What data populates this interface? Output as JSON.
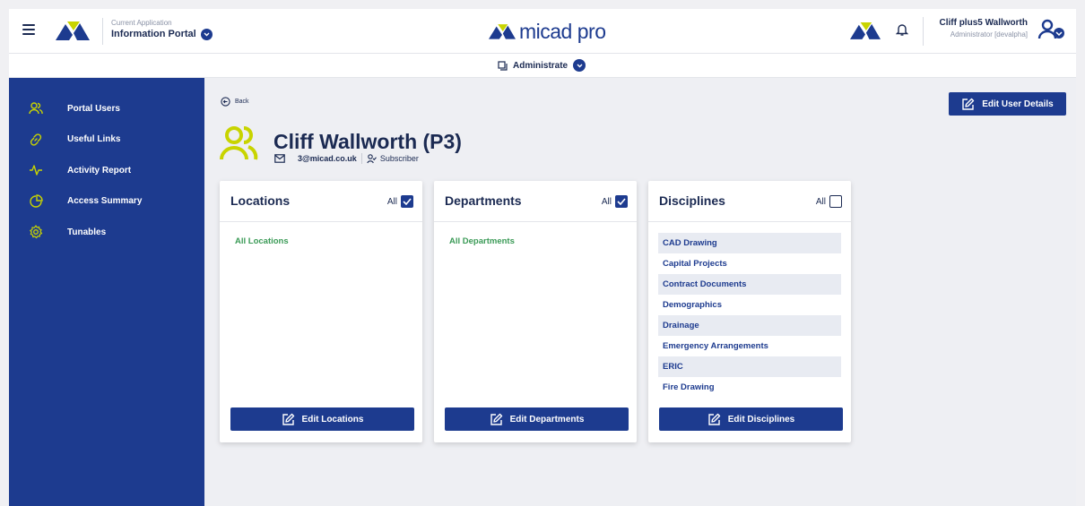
{
  "header": {
    "current_app_caption": "Current Application",
    "current_app_name": "Information Portal",
    "brand_name": "micad pro",
    "user_name": "Cliff plus5 Wallworth",
    "user_role": "Administrator [devalpha]"
  },
  "subheader": {
    "menu_label": "Administrate"
  },
  "sidebar": {
    "items": [
      {
        "label": "Portal Users",
        "icon": "users-icon"
      },
      {
        "label": "Useful Links",
        "icon": "link-icon"
      },
      {
        "label": "Activity Report",
        "icon": "activity-icon"
      },
      {
        "label": "Access Summary",
        "icon": "pie-chart-icon"
      },
      {
        "label": "Tunables",
        "icon": "gear-icon"
      }
    ]
  },
  "main": {
    "back_label": "Back",
    "edit_user_label": "Edit User Details",
    "profile": {
      "name": "Cliff Wallworth (P3)",
      "email": "3@micad.co.uk",
      "role": "Subscriber"
    },
    "cards": {
      "locations": {
        "title": "Locations",
        "all_label": "All",
        "all_checked": true,
        "item": "All Locations",
        "button": "Edit Locations"
      },
      "departments": {
        "title": "Departments",
        "all_label": "All",
        "all_checked": true,
        "item": "All Departments",
        "button": "Edit Departments"
      },
      "disciplines": {
        "title": "Disciplines",
        "all_label": "All",
        "all_checked": false,
        "items": [
          "CAD Drawing",
          "Capital Projects",
          "Contract Documents",
          "Demographics",
          "Drainage",
          "Emergency Arrangements",
          "ERIC",
          "Fire Drawing"
        ],
        "button": "Edit Disciplines"
      }
    }
  },
  "colors": {
    "primary": "#1d3b8f",
    "accent": "#c8d400",
    "link_green": "#3a9a56",
    "text": "#1b2a52"
  }
}
